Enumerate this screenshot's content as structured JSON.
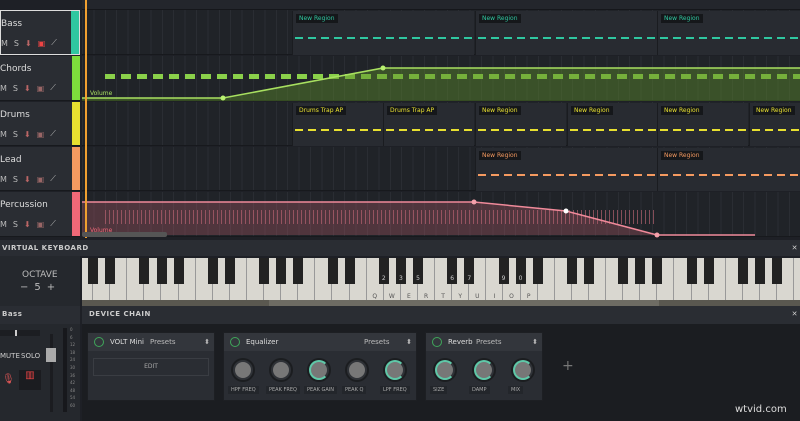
{
  "tracks": [
    {
      "name": "Bass",
      "color": "#2fc7a0",
      "controls": [
        "M",
        "S"
      ]
    },
    {
      "name": "Chords",
      "color": "#7ddc3c",
      "controls": [
        "M",
        "S"
      ]
    },
    {
      "name": "Drums",
      "color": "#e8e030",
      "controls": [
        "M",
        "S"
      ]
    },
    {
      "name": "Lead",
      "color": "#f59a60",
      "controls": [
        "M",
        "S"
      ]
    },
    {
      "name": "Percussion",
      "color": "#f06878",
      "controls": [
        "M",
        "S"
      ]
    }
  ],
  "regions": {
    "bass": [
      "New Region",
      "New Region",
      "New Region"
    ],
    "drums": [
      "Drums Trap AP",
      "Drums Trap AP",
      "New Region",
      "New Region",
      "New Region",
      "New Region"
    ],
    "lead": [
      "New Region",
      "New Region"
    ]
  },
  "automation": {
    "chords_label": "Volume",
    "percussion_label": "Volume"
  },
  "keyboard": {
    "title": "VIRTUAL KEYBOARD",
    "octave_label": "OCTAVE",
    "octave_value": "5",
    "minus": "−",
    "plus": "+",
    "black_labels": [
      "2",
      "3",
      "5",
      "6",
      "7",
      "9",
      "0"
    ],
    "white_labels": [
      "Q",
      "W",
      "E",
      "R",
      "T",
      "Y",
      "U",
      "I",
      "O",
      "P"
    ]
  },
  "mixer": {
    "track": "Bass",
    "mute": "MUTE",
    "solo": "SOLO",
    "meter_ticks": [
      "0",
      "6",
      "12",
      "18",
      "24",
      "30",
      "36",
      "42",
      "48",
      "54",
      "60"
    ]
  },
  "device_chain": {
    "title": "DEVICE CHAIN",
    "add": "+",
    "devices": [
      {
        "name": "VOLT Mini",
        "presets": "Presets",
        "edit": "EDIT"
      },
      {
        "name": "Equalizer",
        "presets": "Presets",
        "knobs": [
          "HPF FREQ",
          "PEAK FREQ",
          "PEAK GAIN",
          "PEAK Q",
          "LPF FREQ"
        ]
      },
      {
        "name": "Reverb",
        "presets": "Presets",
        "knobs": [
          "SIZE",
          "DAMP",
          "MIX"
        ]
      }
    ]
  },
  "watermark": "wtvid.com"
}
